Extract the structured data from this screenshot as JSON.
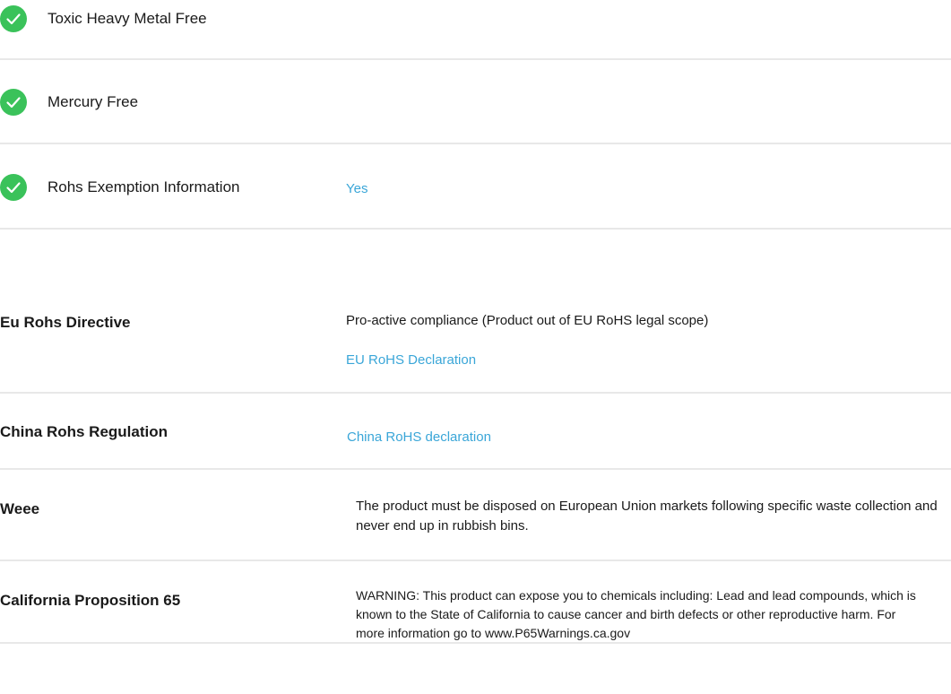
{
  "checks": [
    {
      "label": "Toxic Heavy Metal Free",
      "value": ""
    },
    {
      "label": "Mercury Free",
      "value": ""
    },
    {
      "label": "Rohs Exemption Information",
      "value": "Yes"
    }
  ],
  "compliance": {
    "eu_rohs": {
      "label": "Eu Rohs Directive",
      "text": "Pro-active compliance (Product out of EU RoHS legal scope)",
      "link": "EU RoHS Declaration"
    },
    "china_rohs": {
      "label": "China Rohs Regulation",
      "link": "China RoHS declaration"
    },
    "weee": {
      "label": "Weee",
      "text": "The product must be disposed on European Union markets following specific waste collection and never end up in rubbish bins."
    },
    "ca_prop65": {
      "label": "California Proposition 65",
      "text": "WARNING: This product can expose you to chemicals including: Lead and lead compounds, which is known to the State of California to cause cancer and birth defects or other reproductive harm. For more information go to www.P65Warnings.ca.gov"
    }
  },
  "colors": {
    "check_green": "#3ac25a",
    "link_blue": "#3aa6d8",
    "divider": "#e8e8e8"
  },
  "icons": {
    "check": "check-circle-icon"
  }
}
